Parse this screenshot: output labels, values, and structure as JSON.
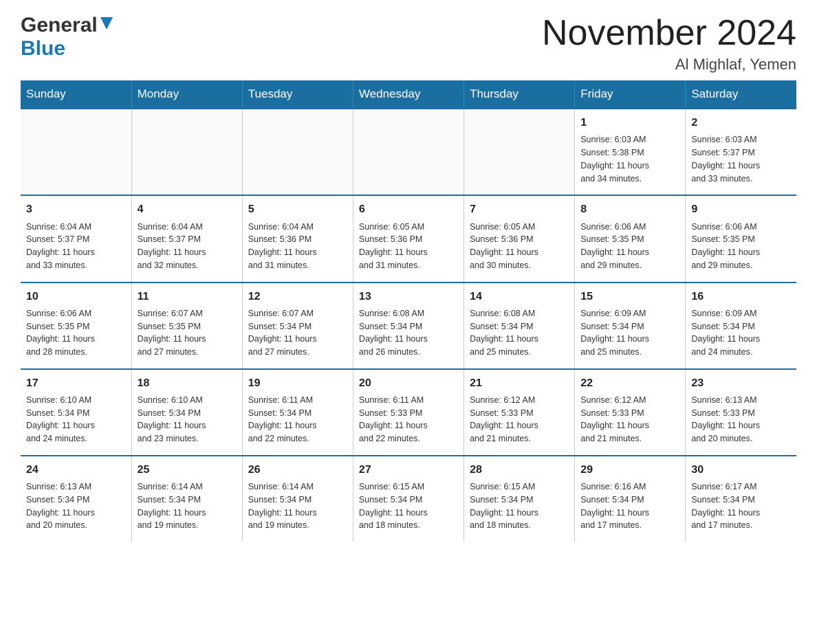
{
  "header": {
    "logo_general": "General",
    "logo_blue": "Blue",
    "month_title": "November 2024",
    "location": "Al Mighlaf, Yemen"
  },
  "days_of_week": [
    "Sunday",
    "Monday",
    "Tuesday",
    "Wednesday",
    "Thursday",
    "Friday",
    "Saturday"
  ],
  "weeks": [
    [
      {
        "day": "",
        "info": ""
      },
      {
        "day": "",
        "info": ""
      },
      {
        "day": "",
        "info": ""
      },
      {
        "day": "",
        "info": ""
      },
      {
        "day": "",
        "info": ""
      },
      {
        "day": "1",
        "info": "Sunrise: 6:03 AM\nSunset: 5:38 PM\nDaylight: 11 hours\nand 34 minutes."
      },
      {
        "day": "2",
        "info": "Sunrise: 6:03 AM\nSunset: 5:37 PM\nDaylight: 11 hours\nand 33 minutes."
      }
    ],
    [
      {
        "day": "3",
        "info": "Sunrise: 6:04 AM\nSunset: 5:37 PM\nDaylight: 11 hours\nand 33 minutes."
      },
      {
        "day": "4",
        "info": "Sunrise: 6:04 AM\nSunset: 5:37 PM\nDaylight: 11 hours\nand 32 minutes."
      },
      {
        "day": "5",
        "info": "Sunrise: 6:04 AM\nSunset: 5:36 PM\nDaylight: 11 hours\nand 31 minutes."
      },
      {
        "day": "6",
        "info": "Sunrise: 6:05 AM\nSunset: 5:36 PM\nDaylight: 11 hours\nand 31 minutes."
      },
      {
        "day": "7",
        "info": "Sunrise: 6:05 AM\nSunset: 5:36 PM\nDaylight: 11 hours\nand 30 minutes."
      },
      {
        "day": "8",
        "info": "Sunrise: 6:06 AM\nSunset: 5:35 PM\nDaylight: 11 hours\nand 29 minutes."
      },
      {
        "day": "9",
        "info": "Sunrise: 6:06 AM\nSunset: 5:35 PM\nDaylight: 11 hours\nand 29 minutes."
      }
    ],
    [
      {
        "day": "10",
        "info": "Sunrise: 6:06 AM\nSunset: 5:35 PM\nDaylight: 11 hours\nand 28 minutes."
      },
      {
        "day": "11",
        "info": "Sunrise: 6:07 AM\nSunset: 5:35 PM\nDaylight: 11 hours\nand 27 minutes."
      },
      {
        "day": "12",
        "info": "Sunrise: 6:07 AM\nSunset: 5:34 PM\nDaylight: 11 hours\nand 27 minutes."
      },
      {
        "day": "13",
        "info": "Sunrise: 6:08 AM\nSunset: 5:34 PM\nDaylight: 11 hours\nand 26 minutes."
      },
      {
        "day": "14",
        "info": "Sunrise: 6:08 AM\nSunset: 5:34 PM\nDaylight: 11 hours\nand 25 minutes."
      },
      {
        "day": "15",
        "info": "Sunrise: 6:09 AM\nSunset: 5:34 PM\nDaylight: 11 hours\nand 25 minutes."
      },
      {
        "day": "16",
        "info": "Sunrise: 6:09 AM\nSunset: 5:34 PM\nDaylight: 11 hours\nand 24 minutes."
      }
    ],
    [
      {
        "day": "17",
        "info": "Sunrise: 6:10 AM\nSunset: 5:34 PM\nDaylight: 11 hours\nand 24 minutes."
      },
      {
        "day": "18",
        "info": "Sunrise: 6:10 AM\nSunset: 5:34 PM\nDaylight: 11 hours\nand 23 minutes."
      },
      {
        "day": "19",
        "info": "Sunrise: 6:11 AM\nSunset: 5:34 PM\nDaylight: 11 hours\nand 22 minutes."
      },
      {
        "day": "20",
        "info": "Sunrise: 6:11 AM\nSunset: 5:33 PM\nDaylight: 11 hours\nand 22 minutes."
      },
      {
        "day": "21",
        "info": "Sunrise: 6:12 AM\nSunset: 5:33 PM\nDaylight: 11 hours\nand 21 minutes."
      },
      {
        "day": "22",
        "info": "Sunrise: 6:12 AM\nSunset: 5:33 PM\nDaylight: 11 hours\nand 21 minutes."
      },
      {
        "day": "23",
        "info": "Sunrise: 6:13 AM\nSunset: 5:33 PM\nDaylight: 11 hours\nand 20 minutes."
      }
    ],
    [
      {
        "day": "24",
        "info": "Sunrise: 6:13 AM\nSunset: 5:34 PM\nDaylight: 11 hours\nand 20 minutes."
      },
      {
        "day": "25",
        "info": "Sunrise: 6:14 AM\nSunset: 5:34 PM\nDaylight: 11 hours\nand 19 minutes."
      },
      {
        "day": "26",
        "info": "Sunrise: 6:14 AM\nSunset: 5:34 PM\nDaylight: 11 hours\nand 19 minutes."
      },
      {
        "day": "27",
        "info": "Sunrise: 6:15 AM\nSunset: 5:34 PM\nDaylight: 11 hours\nand 18 minutes."
      },
      {
        "day": "28",
        "info": "Sunrise: 6:15 AM\nSunset: 5:34 PM\nDaylight: 11 hours\nand 18 minutes."
      },
      {
        "day": "29",
        "info": "Sunrise: 6:16 AM\nSunset: 5:34 PM\nDaylight: 11 hours\nand 17 minutes."
      },
      {
        "day": "30",
        "info": "Sunrise: 6:17 AM\nSunset: 5:34 PM\nDaylight: 11 hours\nand 17 minutes."
      }
    ]
  ]
}
